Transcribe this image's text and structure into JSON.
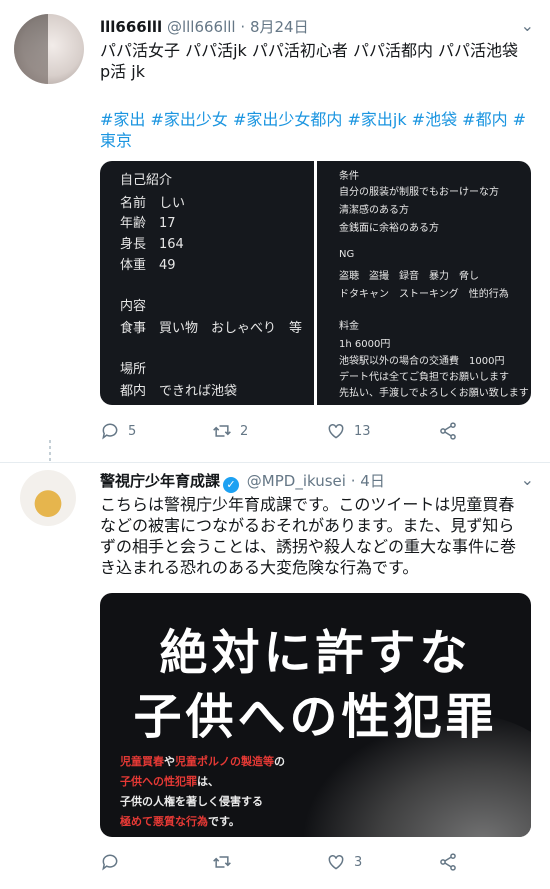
{
  "tweet1": {
    "display_name": "lll666lll",
    "handle": "@lll666lll",
    "date": "8月24日",
    "text": "パパ活女子 パパ活jk パパ活初心者 パパ活都内 パパ活池袋 p活 jk",
    "hashtags": "#家出 #家出少女 #家出少女都内 #家出jk #池袋 #都内 #東京",
    "image_left": [
      "自己紹介",
      "名前　しい",
      "年齢　17",
      "身長　164",
      "体重　49",
      "内容",
      "食事　買い物　おしゃべり　等",
      "場所",
      "都内　できれば池袋"
    ],
    "image_right": [
      "条件",
      "自分の服装が制服でもおーけーな方",
      "清潔感のある方",
      "金銭面に余裕のある方",
      "NG",
      "盗聴　盗撮　録音　暴力　脅し",
      "ドタキャン　ストーキング　性的行為",
      "料金",
      "1h 6000円",
      "池袋駅以外の場合の交通費　1000円",
      "デート代は全てご負担でお願いします",
      "先払い、手渡しでよろしくお願い致します"
    ],
    "replies": "5",
    "retweets": "2",
    "likes": "13"
  },
  "tweet2": {
    "display_name": "警視庁少年育成課",
    "verified_mark": "✓",
    "handle": "@MPD_ikusei",
    "date": "4日",
    "text": "こちらは警視庁少年育成課です。このツイートは児童買春などの被害につながるおそれがあります。また、見ず知らずの相手と会うことは、誘拐や殺人などの重大な事件に巻き込まれる恐れのある大変危険な行為です。",
    "poster_line1": "絶対に許すな",
    "poster_line2": "子供への性犯罪",
    "poster_small": [
      {
        "a": "児童買春",
        "b": "や",
        "c": "児童ポルノの製造等",
        "d": "の"
      },
      {
        "a": "子供への性犯罪",
        "b": "は、"
      },
      {
        "b": "子供の人権を著しく侵害する"
      },
      {
        "a": "極めて悪質な行為",
        "b": "です。"
      }
    ],
    "replies": "",
    "retweets": "",
    "likes": "3"
  },
  "icons": [
    "reply-icon",
    "retweet-icon",
    "like-icon",
    "share-icon",
    "chevron-down-icon",
    "verified-icon"
  ]
}
